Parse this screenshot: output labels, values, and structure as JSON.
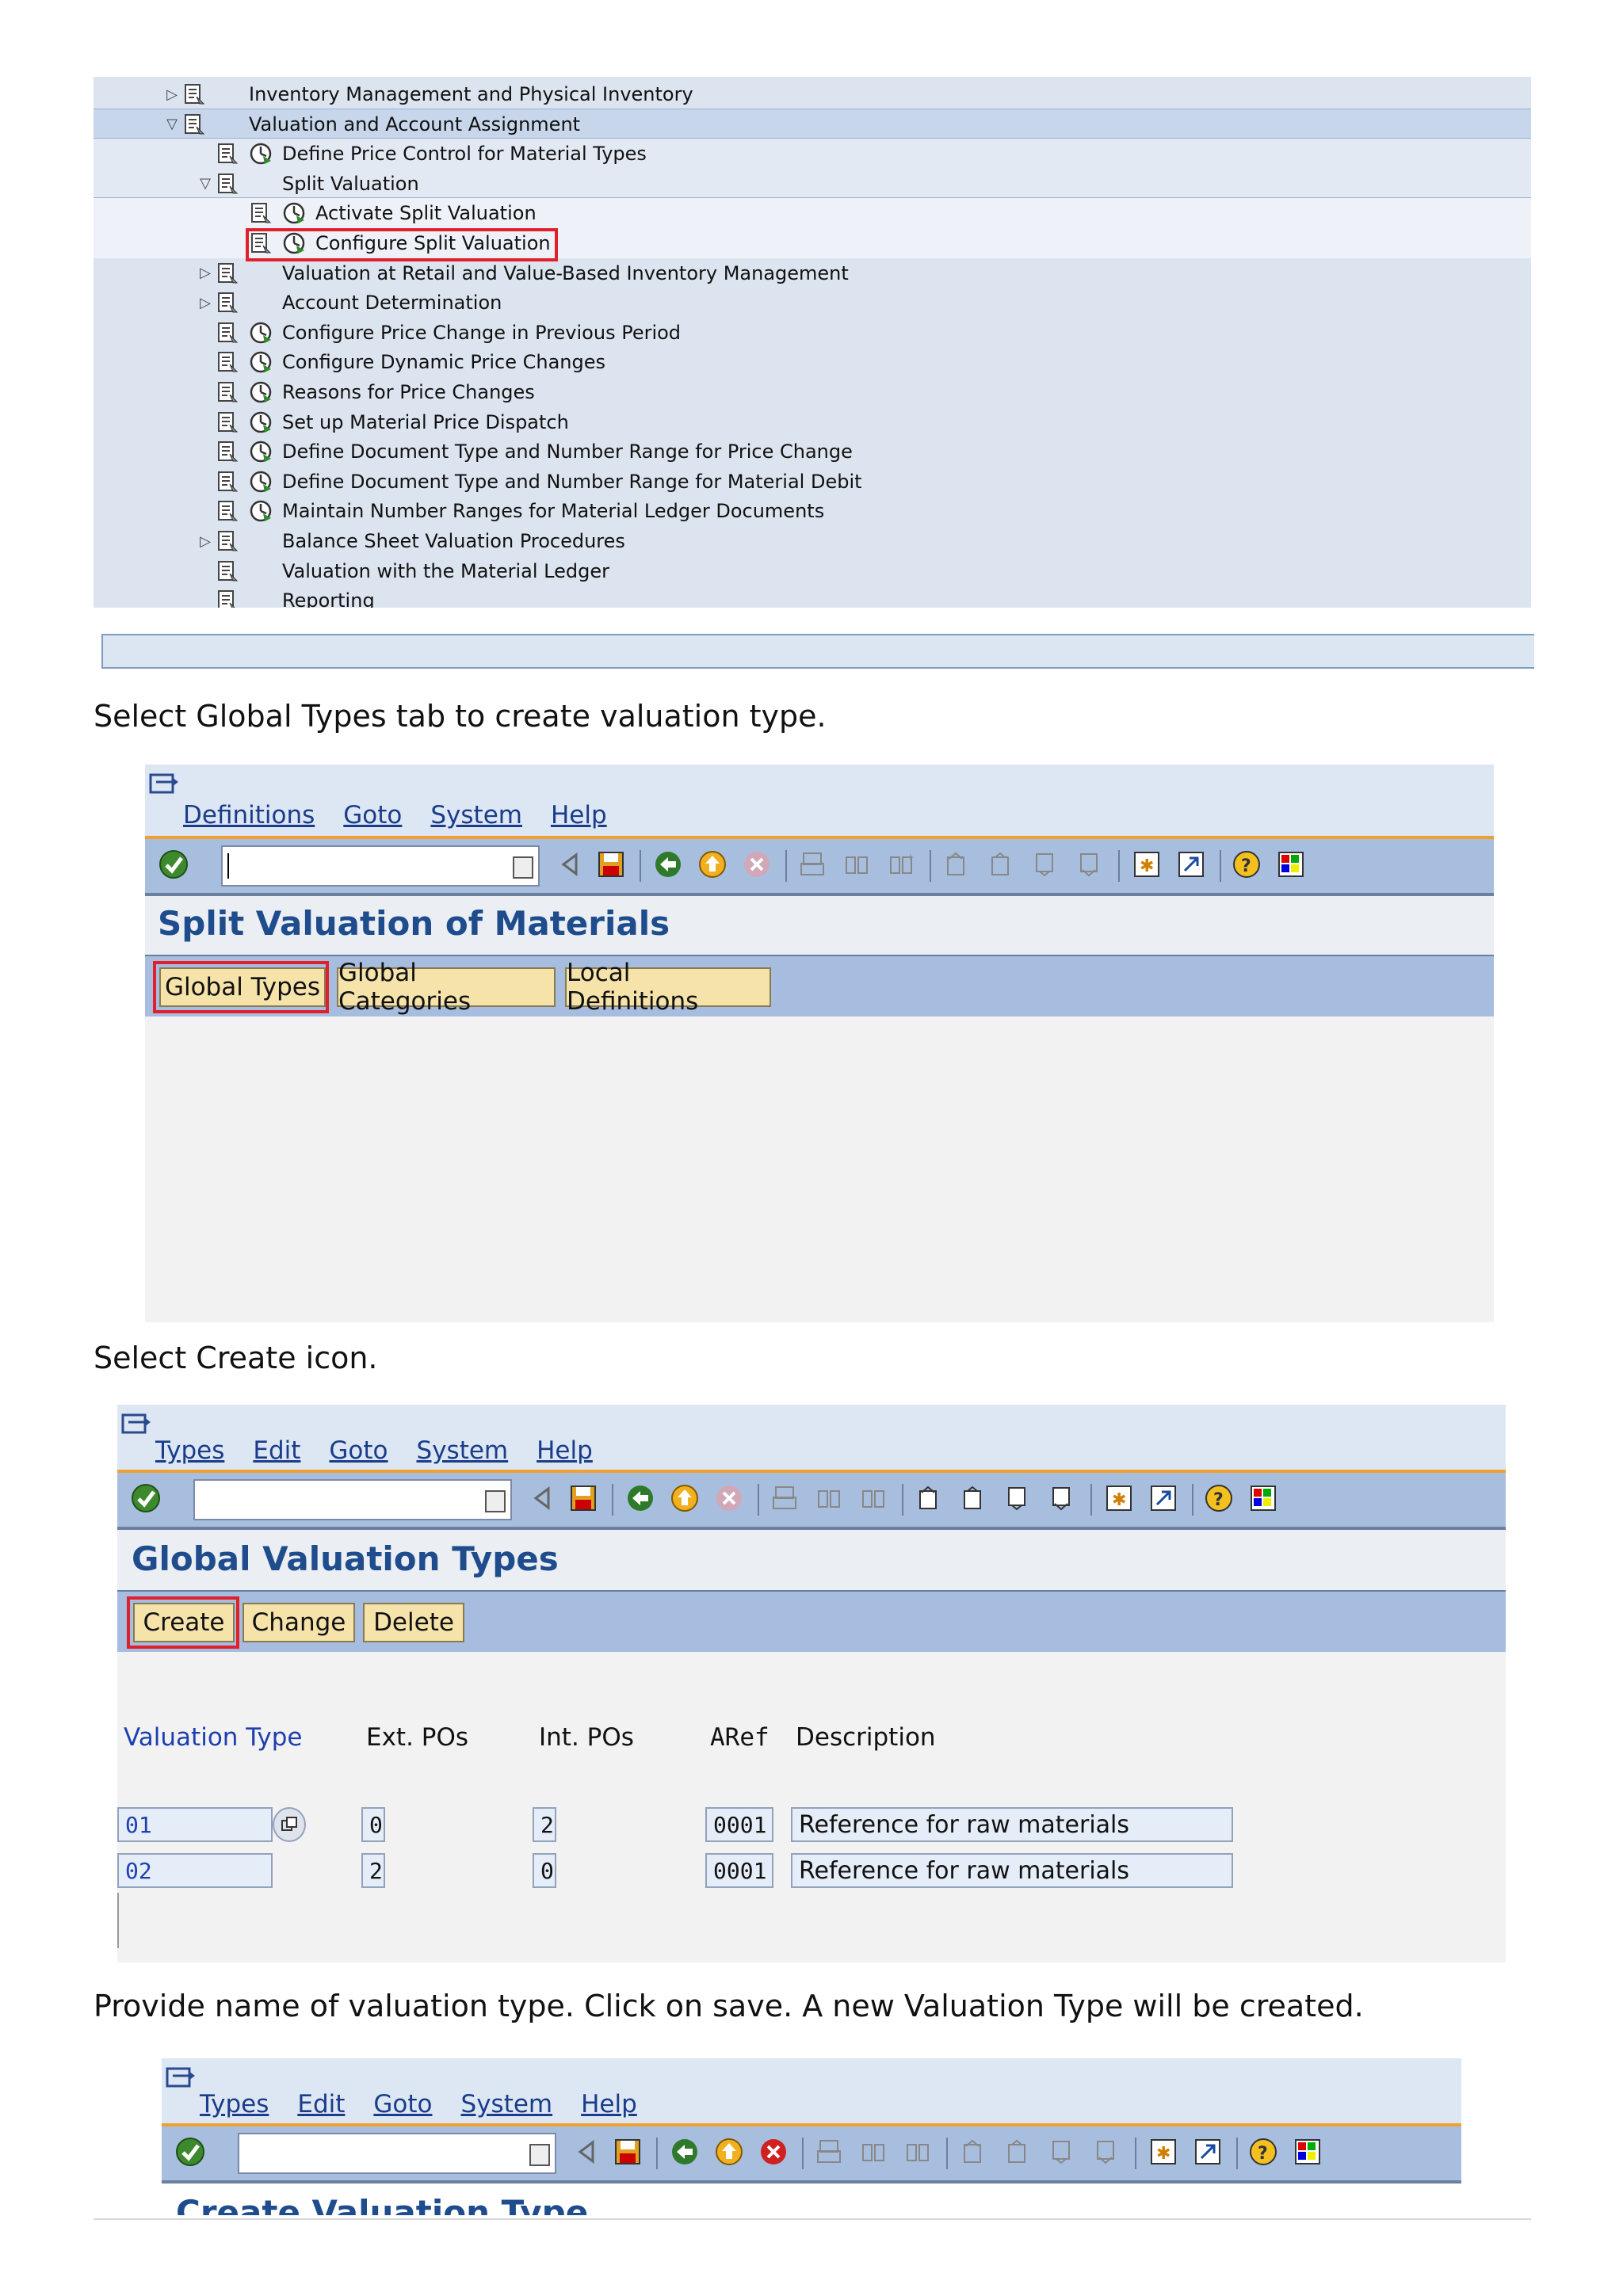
{
  "tree": {
    "nodes": [
      {
        "label": "Inventory Management and Physical Inventory",
        "expand": "collapsed",
        "level": 0,
        "exec": false
      },
      {
        "label": "Valuation and Account Assignment",
        "expand": "expanded",
        "level": 0,
        "exec": false
      },
      {
        "label": "Define Price Control for Material Types",
        "expand": "none",
        "level": 1,
        "exec": true
      },
      {
        "label": "Split Valuation",
        "expand": "expanded",
        "level": 1,
        "exec": false
      },
      {
        "label": "Activate Split Valuation",
        "expand": "none",
        "level": 2,
        "exec": true
      },
      {
        "label": "Configure Split Valuation",
        "expand": "none",
        "level": 2,
        "exec": true
      },
      {
        "label": "Valuation at Retail and Value-Based Inventory Management",
        "expand": "collapsed",
        "level": 1,
        "exec": false
      },
      {
        "label": "Account Determination",
        "expand": "collapsed",
        "level": 1,
        "exec": false
      },
      {
        "label": "Configure Price Change in Previous Period",
        "expand": "none",
        "level": 1,
        "exec": true
      },
      {
        "label": "Configure Dynamic Price Changes",
        "expand": "none",
        "level": 1,
        "exec": true
      },
      {
        "label": "Reasons for Price Changes",
        "expand": "none",
        "level": 1,
        "exec": true
      },
      {
        "label": "Set up Material Price Dispatch",
        "expand": "none",
        "level": 1,
        "exec": true
      },
      {
        "label": "Define Document Type and Number Range for Price Change",
        "expand": "none",
        "level": 1,
        "exec": true
      },
      {
        "label": "Define Document Type and Number Range for Material Debit",
        "expand": "none",
        "level": 1,
        "exec": true
      },
      {
        "label": "Maintain Number Ranges for Material Ledger Documents",
        "expand": "none",
        "level": 1,
        "exec": true
      },
      {
        "label": "Balance Sheet Valuation Procedures",
        "expand": "collapsed",
        "level": 1,
        "exec": false
      },
      {
        "label": "Valuation with the Material Ledger",
        "expand": "none",
        "level": 1,
        "exec": false
      },
      {
        "label": "Reporting",
        "expand": "none",
        "level": 1,
        "exec": false
      }
    ],
    "highlighted": "Configure Split Valuation"
  },
  "instructions": {
    "step1": "Select Global Types tab to create valuation type.",
    "step2": "Select Create icon.",
    "step3": "Provide name of valuation type. Click on save. A new Valuation Type will be created."
  },
  "window1": {
    "menu": [
      "Definitions",
      "Goto",
      "System",
      "Help"
    ],
    "title": "Split Valuation of Materials",
    "tabs": [
      "Global Types",
      "Global Categories",
      "Local Definitions"
    ],
    "highlighted_tab": "Global Types"
  },
  "window2": {
    "menu": [
      "Types",
      "Edit",
      "Goto",
      "System",
      "Help"
    ],
    "title": "Global Valuation Types",
    "buttons": [
      "Create",
      "Change",
      "Delete"
    ],
    "highlighted_button": "Create",
    "columns": [
      "Valuation Type",
      "Ext. POs",
      "Int. POs",
      "ARef",
      "Description"
    ],
    "rows": [
      {
        "valuation_type": "01",
        "ext_pos": "0",
        "int_pos": "2",
        "aref": "0001",
        "description": "Reference for raw materials"
      },
      {
        "valuation_type": "02",
        "ext_pos": "2",
        "int_pos": "0",
        "aref": "0001",
        "description": "Reference for raw materials"
      }
    ]
  },
  "window3": {
    "menu": [
      "Types",
      "Edit",
      "Goto",
      "System",
      "Help"
    ],
    "title": "Create Valuation Type"
  },
  "colors": {
    "tree_bg": "#dce4ef",
    "toolbar_bg": "#a8bede",
    "toolbar_accent": "#f0a030",
    "title_blue": "#1e4c8c",
    "tab_yellow": "#f6e3aa",
    "highlight_red": "#e0202a"
  }
}
